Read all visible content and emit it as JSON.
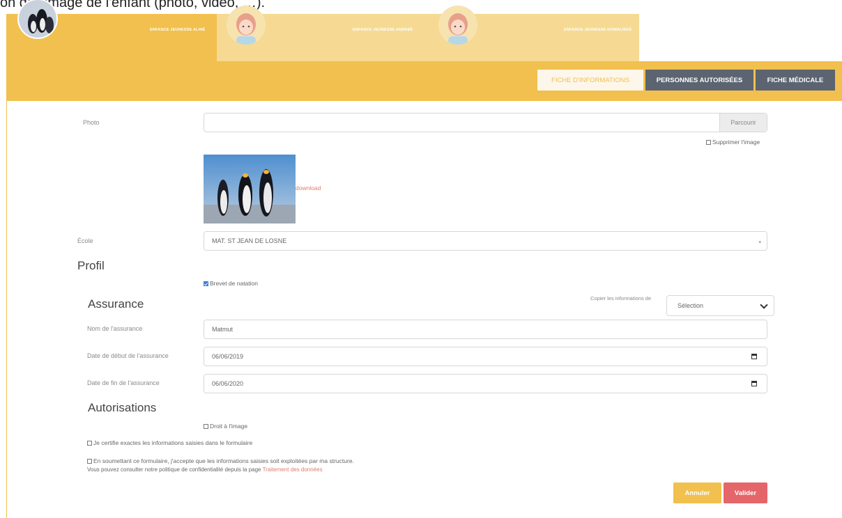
{
  "caption": "on de l'image de l'enfant (photo, vidéo, …).",
  "children_tabs": [
    {
      "label": "Enfance jeunesse Alinë"
    },
    {
      "label": "Enfance jeunesse Andreë"
    },
    {
      "label": "Enfance jeunesse Kowaliskë"
    }
  ],
  "page_tabs": [
    {
      "label": "Fiche d'informations",
      "active": true
    },
    {
      "label": "Personnes autorisées",
      "active": false
    },
    {
      "label": "Fiche médicale",
      "active": false
    }
  ],
  "photo": {
    "label": "Photo",
    "browse_label": "Parcourir",
    "delete_label": "Supprimer l'image",
    "download_label": "download"
  },
  "ecole": {
    "label": "École",
    "value": "MAT. ST JEAN DE LOSNE"
  },
  "profil": {
    "title": "Profil",
    "swim_label": "Brevet de natation",
    "swim_checked": true
  },
  "assurance": {
    "title": "Assurance",
    "copy_label": "Copier les informations de",
    "copy_select": "Sélection",
    "name_label": "Nom de l'assurance",
    "name_value": "Matmut",
    "start_label": "Date de début de l'assurance",
    "start_value": "06/06/2019",
    "end_label": "Date de fin de l'assurance",
    "end_value": "06/06/2020"
  },
  "autorisations": {
    "title": "Autorisations",
    "image_right_label": "Droit à l'image",
    "certify_label": "Je certifie exactes les informations saisies dans le formulaire",
    "consent_label": "En soumettant ce formulaire, j'accepte que les informations saisies soit exploitées par ma structure.",
    "policy_text": "Vous pouvez consulter notre politique de confidentialité depuis la page",
    "policy_link": "Traitement des données"
  },
  "actions": {
    "cancel": "Annuler",
    "submit": "Valider"
  },
  "colors": {
    "brand_yellow": "#f1c04e",
    "dark_tab": "#5b6470",
    "submit_red": "#e4666a"
  }
}
